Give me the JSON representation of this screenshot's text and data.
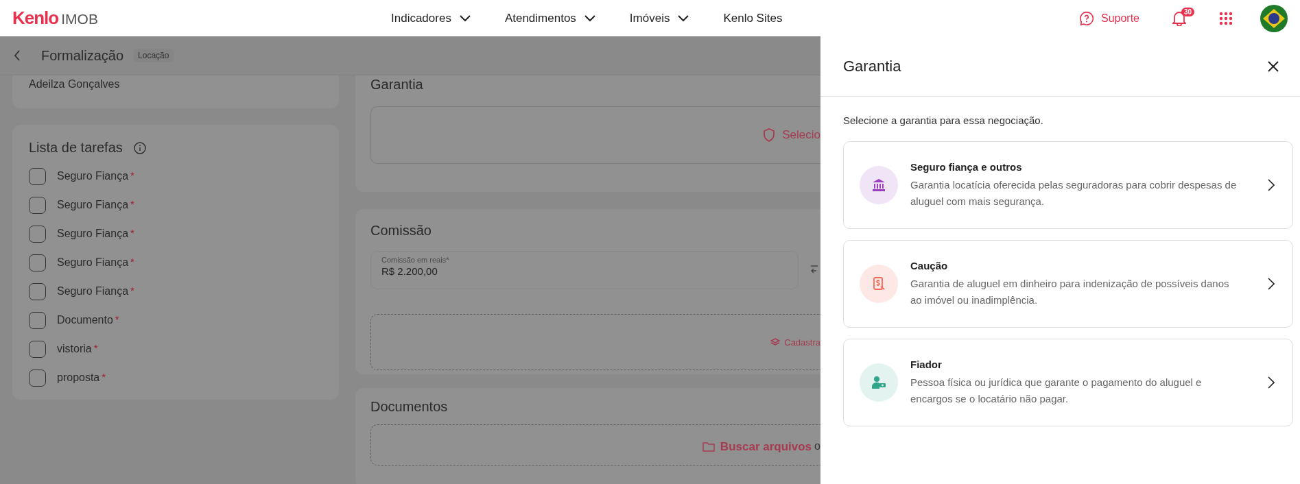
{
  "header": {
    "logo": {
      "brand": "Kenlo",
      "product": "IMOB"
    },
    "nav": [
      {
        "label": "Indicadores",
        "dropdown": true
      },
      {
        "label": "Atendimentos",
        "dropdown": true
      },
      {
        "label": "Imóveis",
        "dropdown": true
      },
      {
        "label": "Kenlo Sites",
        "dropdown": false
      }
    ],
    "support": "Suporte",
    "notifications": "30"
  },
  "subheader": {
    "title": "Formalização",
    "tag": "Locação"
  },
  "client_card": {
    "name": "Adeilza Gonçalves"
  },
  "tasks": {
    "title": "Lista de tarefas",
    "items": [
      {
        "label": "Seguro Fiança",
        "required_mark": "*",
        "checked": false
      },
      {
        "label": "Seguro Fiança",
        "required_mark": "*",
        "checked": false
      },
      {
        "label": "Seguro Fiança",
        "required_mark": "*",
        "checked": false
      },
      {
        "label": "Seguro Fiança",
        "required_mark": "*",
        "checked": false
      },
      {
        "label": "Seguro Fiança",
        "required_mark": "*",
        "checked": false
      },
      {
        "label": "Documento",
        "required_mark": "*",
        "checked": false
      },
      {
        "label": "vistoria",
        "required_mark": "*",
        "checked": false
      },
      {
        "label": "proposta",
        "required_mark": "*",
        "checked": false
      }
    ]
  },
  "guarantee_section": {
    "title": "Garantia",
    "action": "Selecio"
  },
  "commission": {
    "title": "Comissão",
    "field": {
      "label": "Comissão em reais*",
      "value": "R$ 2.200,00"
    },
    "action": "Cadastra"
  },
  "documents": {
    "title": "Documentos",
    "action": "Buscar arquivos",
    "action_tail": "o"
  },
  "drawer": {
    "title": "Garantia",
    "subtitle": "Selecione a garantia para essa negociação.",
    "options": [
      {
        "kind": "bank",
        "title": "Seguro fiança e outros",
        "description": "Garantia locatícia oferecida pelas seguradoras para cobrir despesas de aluguel com mais segurança.",
        "color": "#f0e4f7"
      },
      {
        "kind": "deposit",
        "title": "Caução",
        "description": "Garantia de aluguel em dinheiro para indenização de possíveis danos ao imóvel ou inadimplência.",
        "color": "#fde8e6"
      },
      {
        "kind": "guarantor",
        "title": "Fiador",
        "description": "Pessoa física ou jurídica que garante o pagamento do aluguel e encargos se o locatário não pagar.",
        "color": "#e3f3ef"
      }
    ]
  }
}
